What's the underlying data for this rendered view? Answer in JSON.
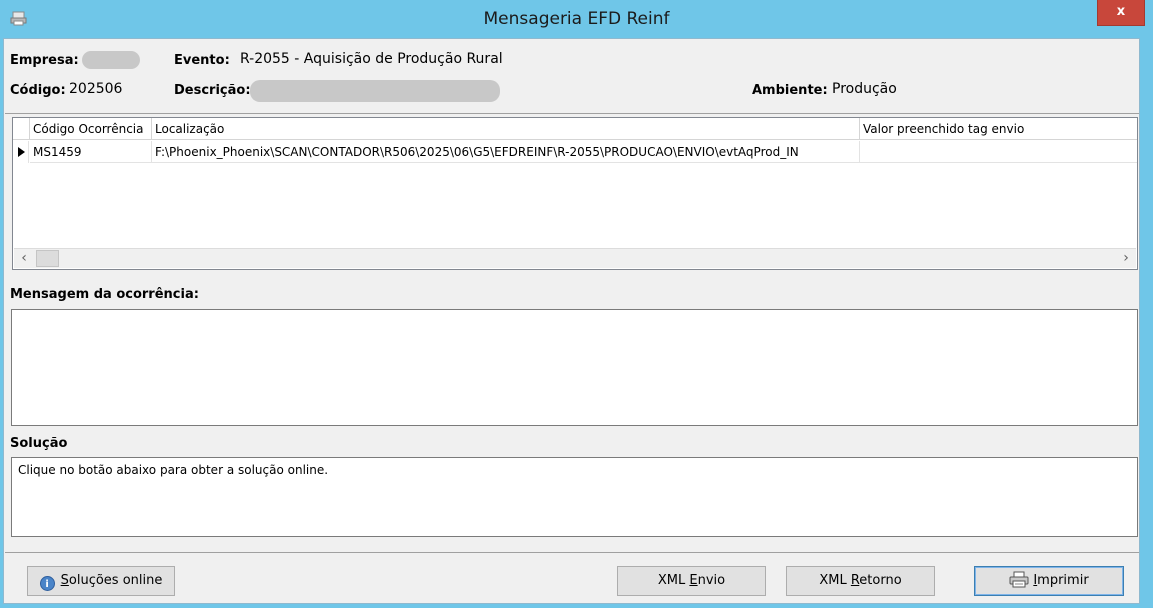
{
  "window": {
    "title": "Mensageria EFD Reinf",
    "close_label": "x"
  },
  "header": {
    "empresa_label": "Empresa:",
    "evento_label": "Evento:",
    "evento_value": "R-2055 - Aquisição de Produção Rural",
    "codigo_label": "Código:",
    "codigo_value": "202506",
    "descricao_label": "Descrição:",
    "ambiente_label": "Ambiente:",
    "ambiente_value": "Produção"
  },
  "grid": {
    "columns": [
      "Código Ocorrência",
      "Localização",
      "Valor preenchido tag envio"
    ],
    "rows": [
      {
        "codigo": "MS1459",
        "localizacao": "F:\\Phoenix_Phoenix\\SCAN\\CONTADOR\\R506\\2025\\06\\G5\\EFDREINF\\R-2055\\PRODUCAO\\ENVIO\\evtAqProd_IN",
        "valor": ""
      }
    ]
  },
  "mensagem": {
    "label": "Mensagem da ocorrência:",
    "text": ""
  },
  "solucao": {
    "label": "Solução",
    "text": "Clique no botão abaixo para obter a solução online."
  },
  "buttons": {
    "solucoes_online_pre": "S",
    "solucoes_online_rest": "oluções online",
    "xml_envio_pre": "XML ",
    "xml_envio_u": "E",
    "xml_envio_rest": "nvio",
    "xml_retorno_pre": "XML ",
    "xml_retorno_u": "R",
    "xml_retorno_rest": "etorno",
    "imprimir_u": "I",
    "imprimir_rest": "mprimir"
  }
}
